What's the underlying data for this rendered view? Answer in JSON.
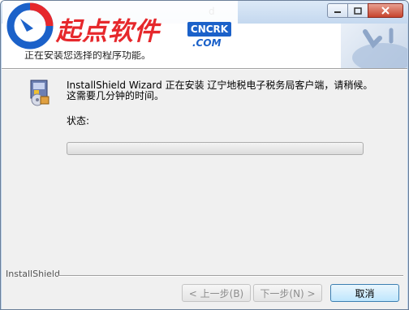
{
  "window": {
    "title_visible": "d",
    "header_subtitle": "正在安装您选择的程序功能。"
  },
  "logo": {
    "text": "起点软件",
    "badge": "CNCRK",
    "domain": ".COM"
  },
  "content": {
    "message_line1": "InstallShield Wizard 正在安装 辽宁地税电子税务局客户端，请稍候。",
    "message_line2": "这需要几分钟的时间。",
    "status_label": "状态:",
    "progress_fraction": 0
  },
  "footer": {
    "brand": "InstallShield",
    "back_label": "< 上一步(B)",
    "next_label": "下一步(N) >",
    "cancel_label": "取消"
  },
  "colors": {
    "logo_red": "#e6282c",
    "logo_blue": "#1b61c9"
  }
}
